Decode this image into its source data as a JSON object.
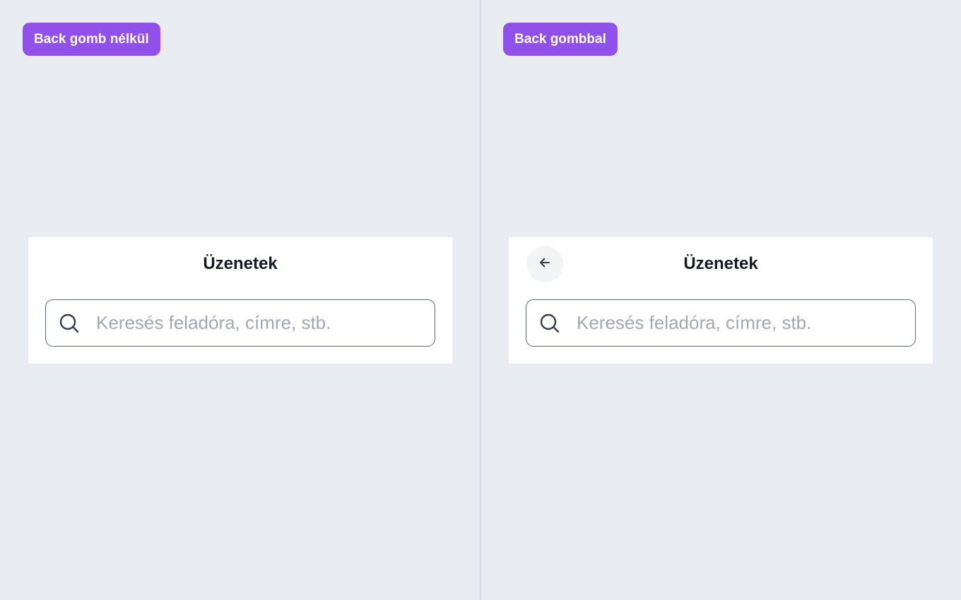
{
  "colors": {
    "background": "#e8ebf0",
    "accent": "#9150ea",
    "card": "#ffffff",
    "title": "#161a22",
    "placeholder": "#a0a7b4",
    "border": "#5d6679"
  },
  "variants": [
    {
      "tag": "Back gomb nélkül",
      "title": "Üzenetek",
      "has_back_button": false,
      "search": {
        "value": "",
        "placeholder": "Keresés feladóra, címre, stb.",
        "icon": "search-icon"
      }
    },
    {
      "tag": "Back gombbal",
      "title": "Üzenetek",
      "has_back_button": true,
      "back_icon": "arrow-left-icon",
      "search": {
        "value": "",
        "placeholder": "Keresés feladóra, címre, stb.",
        "icon": "search-icon"
      }
    }
  ]
}
